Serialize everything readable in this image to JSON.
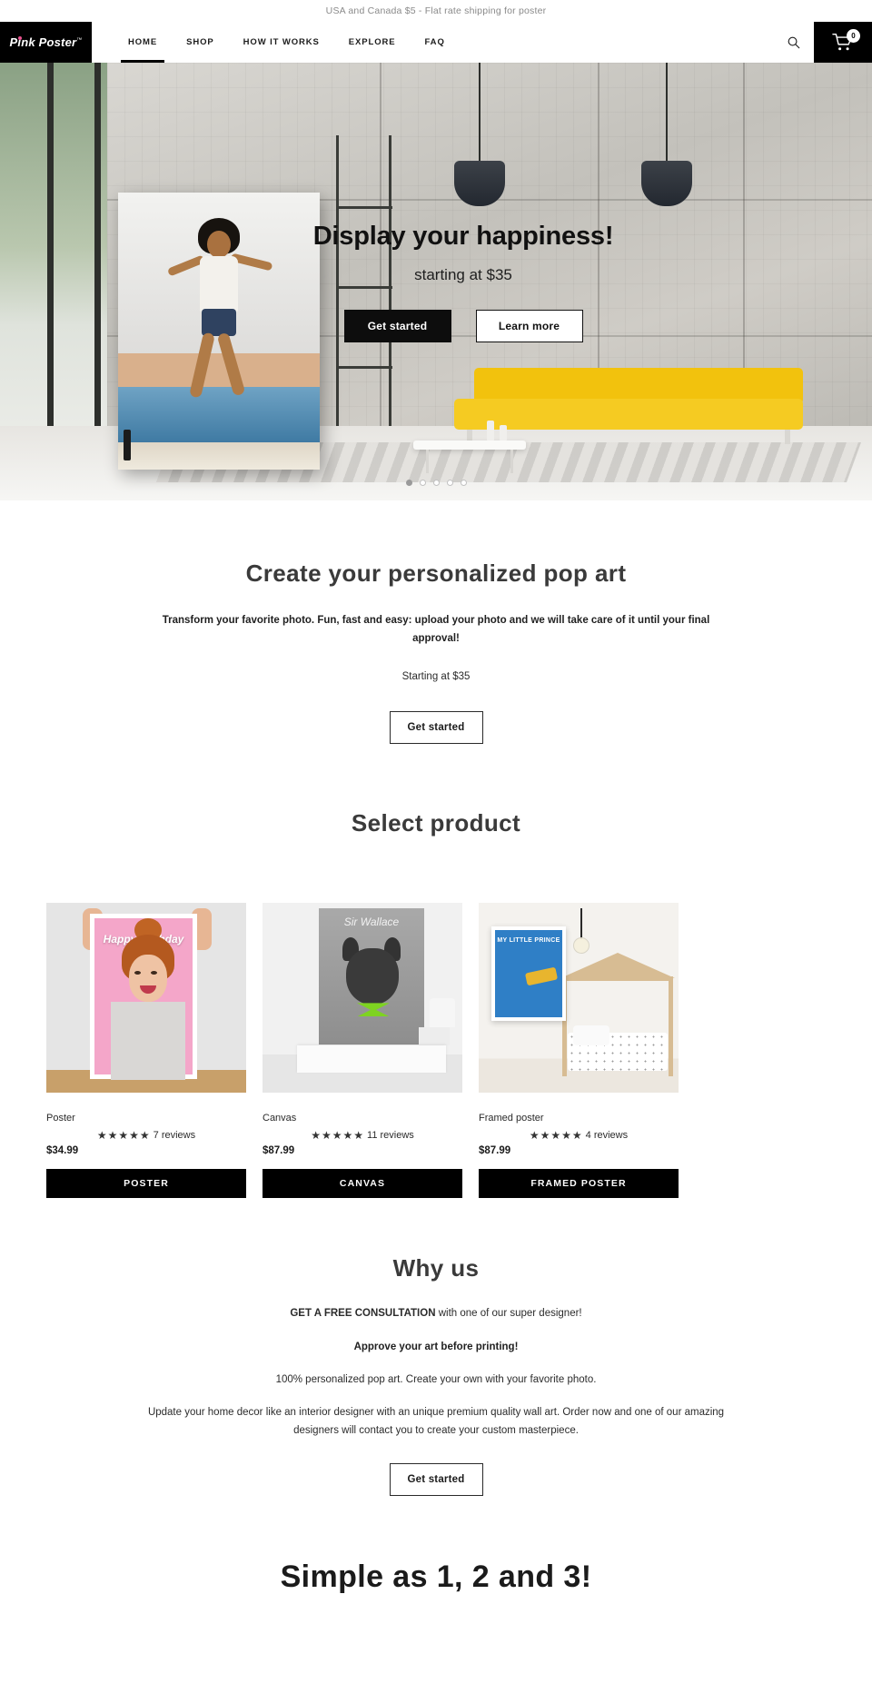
{
  "announcement": {
    "text": "USA and Canada $5 - Flat rate shipping for poster"
  },
  "header": {
    "logo": "Pink Poster",
    "logo_tm": "™",
    "nav": [
      {
        "label": "HOME",
        "active": true
      },
      {
        "label": "SHOP",
        "active": false
      },
      {
        "label": "HOW IT WORKS",
        "active": false
      },
      {
        "label": "EXPLORE",
        "active": false
      },
      {
        "label": "FAQ",
        "active": false
      }
    ],
    "search_icon": "search-icon",
    "cart_icon": "shopping-cart-icon",
    "cart_count": "0"
  },
  "hero": {
    "title": "Display your happiness!",
    "subtitle": "starting at $35",
    "primary_button": "Get started",
    "secondary_button": "Learn more",
    "poster_caption": "",
    "dots": 5,
    "active_dot": 0
  },
  "intro": {
    "title": "Create your personalized pop art",
    "body": "Transform your favorite photo. Fun, fast and easy: upload your photo and we will take care of it until your final approval!",
    "price_note": "Starting at $35",
    "button": "Get started"
  },
  "select_product": {
    "title": "Select product",
    "items": [
      {
        "name": "Poster",
        "stars": "★★★★★",
        "reviews": "7 reviews",
        "price": "$34.99",
        "button": "POSTER",
        "art_caption": "Happy Birthday"
      },
      {
        "name": "Canvas",
        "stars": "★★★★★",
        "reviews": "11 reviews",
        "price": "$87.99",
        "button": "CANVAS",
        "art_caption": "Sir Wallace"
      },
      {
        "name": "Framed poster",
        "stars": "★★★★★",
        "reviews": "4 reviews",
        "price": "$87.99",
        "button": "FRAMED POSTER",
        "art_caption": "MY LITTLE PRINCE"
      }
    ]
  },
  "why_us": {
    "title": "Why us",
    "line1_strong": "GET A FREE CONSULTATION",
    "line1_rest": " with one of our super designer!",
    "line2": "Approve your art before printing!",
    "line3": "100% personalized pop art. Create your own with your favorite photo.",
    "line4": "Update your home decor like an interior designer with an unique premium quality wall art. Order now and one of our amazing designers will contact you to create your custom masterpiece.",
    "button": "Get started"
  },
  "simple": {
    "title": "Simple as 1, 2 and 3!"
  },
  "colors": {
    "brand_pink": "#e8538f",
    "black": "#000000",
    "heading_gray": "#3a3a3a",
    "sofa_yellow": "#f2c20d"
  }
}
